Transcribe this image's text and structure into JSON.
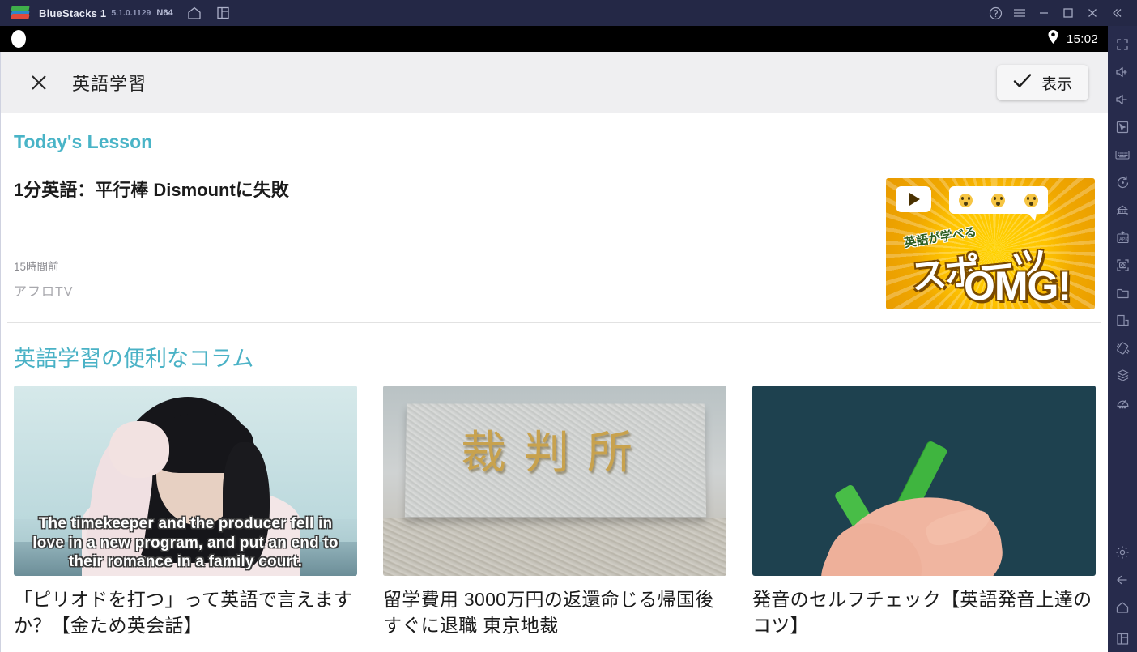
{
  "titlebar": {
    "app_name": "BlueStacks 1",
    "version": "5.1.0.1129",
    "instance": "N64",
    "icons": [
      "home-icon",
      "multi-instance-icon"
    ],
    "controls": [
      "help-icon",
      "menu-icon",
      "minimize-icon",
      "maximize-icon",
      "close-icon",
      "collapse-icon"
    ]
  },
  "statusbar": {
    "time": "15:02",
    "location_icon": "location-pin-icon"
  },
  "app_header": {
    "close_label": "✕",
    "title": "英語学習",
    "action_label": "表示",
    "action_icon": "check-icon"
  },
  "lesson_section": {
    "heading": "Today's Lesson",
    "title": "1分英語：平行棒 Dismountに失敗",
    "time_ago": "15時間前",
    "channel": "アフロTV",
    "thumbnail": {
      "sub_text": "英語が学べる",
      "main_text": "スポーツ",
      "main_text2": "OMG!",
      "play_icon": "play-icon"
    }
  },
  "column_section": {
    "heading": "英語学習の便利なコラム",
    "cards": [
      {
        "title": "「ピリオドを打つ」って英語で言えますか？【金ため英会話】",
        "thumb_caption": "The timekeeper and the producer fell in love in a new program, and put an end to their romance in a family court."
      },
      {
        "title": "留学費用 3000万円の返還命じる帰国後すぐに退職 東京地裁",
        "thumb_text": "裁判所"
      },
      {
        "title": "発音のセルフチェック【英語発音上達のコツ】",
        "thumb_text": ""
      }
    ]
  },
  "toolbar": {
    "items": [
      "fullscreen-icon",
      "volume-up-icon",
      "volume-down-icon",
      "pointer-icon",
      "keyboard-icon",
      "rotate-icon",
      "multi-instance-manager-icon",
      "install-apk-icon",
      "screenshot-icon",
      "media-folder-icon",
      "screen-split-icon",
      "shake-icon",
      "macro-icon",
      "gamepad-icon"
    ],
    "bottom_items": [
      "settings-icon",
      "back-icon",
      "home-icon",
      "recents-icon"
    ]
  },
  "colors": {
    "accent_teal": "#49b4c7",
    "titlebar_bg": "#242846",
    "toolbar_bg": "#272b4c",
    "app_header_bg": "#efeff1"
  }
}
